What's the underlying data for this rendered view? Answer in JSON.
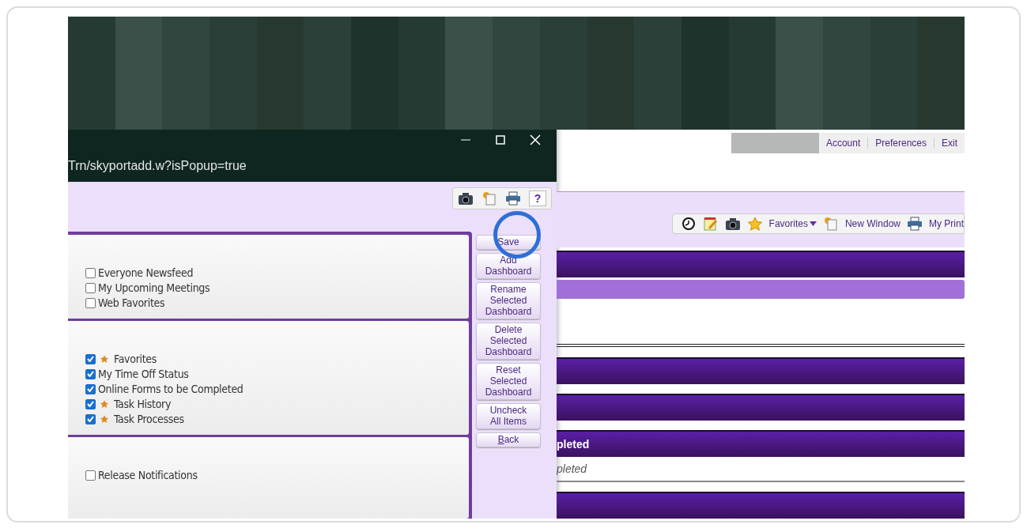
{
  "popup": {
    "url": "Trn/skyportadd.w?isPopup=true",
    "toolbar": [
      {
        "kind": "camera"
      },
      {
        "kind": "new-window"
      },
      {
        "kind": "print"
      },
      {
        "kind": "help",
        "label": "?"
      }
    ],
    "panels": [
      {
        "items": [
          {
            "label": "Everyone Newsfeed",
            "checked": false,
            "starred": false
          },
          {
            "label": "My Upcoming Meetings",
            "checked": false,
            "starred": false
          },
          {
            "label": "Web Favorites",
            "checked": false,
            "starred": false
          }
        ]
      },
      {
        "items": [
          {
            "label": "Favorites",
            "checked": true,
            "starred": true
          },
          {
            "label": "My Time Off Status",
            "checked": true,
            "starred": false
          },
          {
            "label": "Online Forms to be Completed",
            "checked": true,
            "starred": false
          },
          {
            "label": "Task History",
            "checked": true,
            "starred": true
          },
          {
            "label": "Task Processes",
            "checked": true,
            "starred": true
          }
        ]
      },
      {
        "items": [
          {
            "label": "Release Notifications",
            "checked": false,
            "starred": false
          }
        ]
      }
    ],
    "buttons": [
      {
        "lines": [
          "Save"
        ],
        "access_key": false
      },
      {
        "lines": [
          "Add",
          "Dashboard"
        ],
        "access_key": false
      },
      {
        "lines": [
          "Rename",
          "Selected",
          "Dashboard"
        ],
        "access_key": false
      },
      {
        "lines": [
          "Delete",
          "Selected",
          "Dashboard"
        ],
        "access_key": false
      },
      {
        "lines": [
          "Reset",
          "Selected",
          "Dashboard"
        ],
        "access_key": false
      },
      {
        "lines": [
          "Uncheck",
          "All Items"
        ],
        "access_key": false
      },
      {
        "lines": [
          "Back"
        ],
        "access_key": true
      }
    ]
  },
  "page": {
    "account_links": [
      "Account",
      "Preferences",
      "Exit"
    ],
    "toolbar": [
      {
        "kind": "clock"
      },
      {
        "kind": "notepad"
      },
      {
        "kind": "camera"
      },
      {
        "kind": "favorites",
        "label": "Favorites",
        "caret": true
      },
      {
        "kind": "new-window",
        "label": "New Window"
      },
      {
        "kind": "print",
        "label": "My Print"
      }
    ],
    "sections": [
      {
        "kind": "bar"
      },
      {
        "kind": "subbar"
      },
      {
        "kind": "blank"
      },
      {
        "kind": "rule"
      },
      {
        "kind": "bar"
      },
      {
        "kind": "bar"
      },
      {
        "kind": "bar",
        "title": "pleted"
      },
      {
        "kind": "row",
        "text": "pleted"
      },
      {
        "kind": "bar"
      }
    ]
  }
}
